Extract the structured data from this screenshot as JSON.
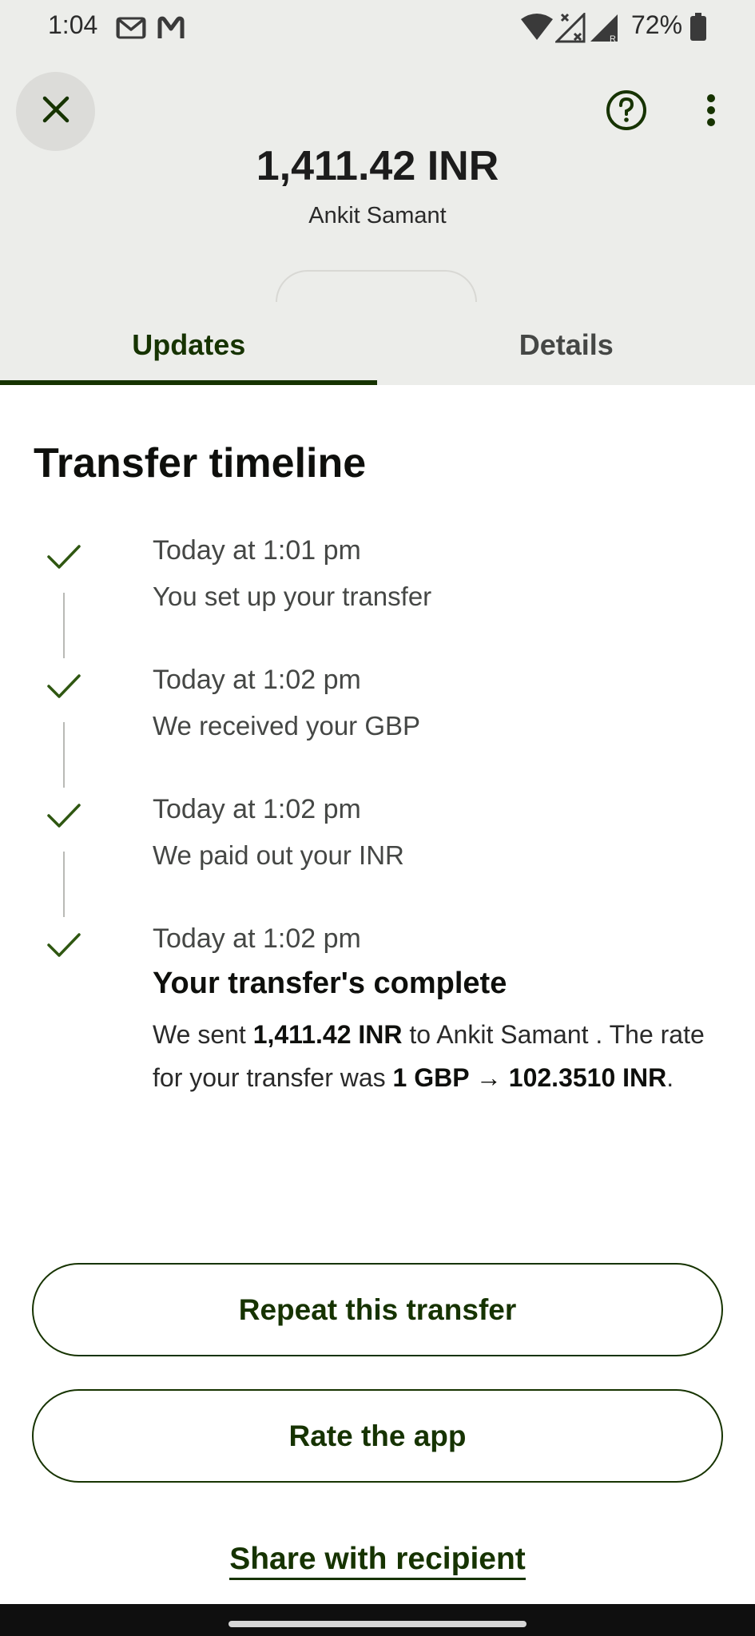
{
  "status_bar": {
    "time": "1:04",
    "battery": "72%",
    "icons": [
      "gmail-icon",
      "m-icon",
      "wifi-icon",
      "no-data-icon",
      "signal-icon",
      "battery-icon"
    ]
  },
  "header": {
    "close_icon": "close-icon",
    "help_icon": "help-icon",
    "more_icon": "more-vert-icon",
    "amount": "1,411.42 INR",
    "recipient": "Ankit Samant"
  },
  "tabs": [
    {
      "label": "Updates",
      "active": true
    },
    {
      "label": "Details",
      "active": false
    }
  ],
  "timeline": {
    "title": "Transfer timeline",
    "items": [
      {
        "time": "Today at 1:01 pm",
        "description": "You set up your transfer"
      },
      {
        "time": "Today at 1:02 pm",
        "description": "We received your GBP"
      },
      {
        "time": "Today at 1:02 pm",
        "description": "We paid out your INR"
      },
      {
        "time": "Today at 1:02 pm",
        "heading": "Your transfer's complete",
        "message": {
          "p1": "We sent ",
          "amount": "1,411.42 INR",
          "p2": " to Ankit Samant . The rate for your transfer was ",
          "rate": "1 GBP → 102.3510 INR",
          "p3": "."
        }
      }
    ]
  },
  "actions": {
    "repeat": "Repeat this transfer",
    "rate": "Rate the app",
    "share": "Share with recipient"
  },
  "colors": {
    "accent": "#163300",
    "header_bg": "#ecedea",
    "check": "#2f5711"
  }
}
